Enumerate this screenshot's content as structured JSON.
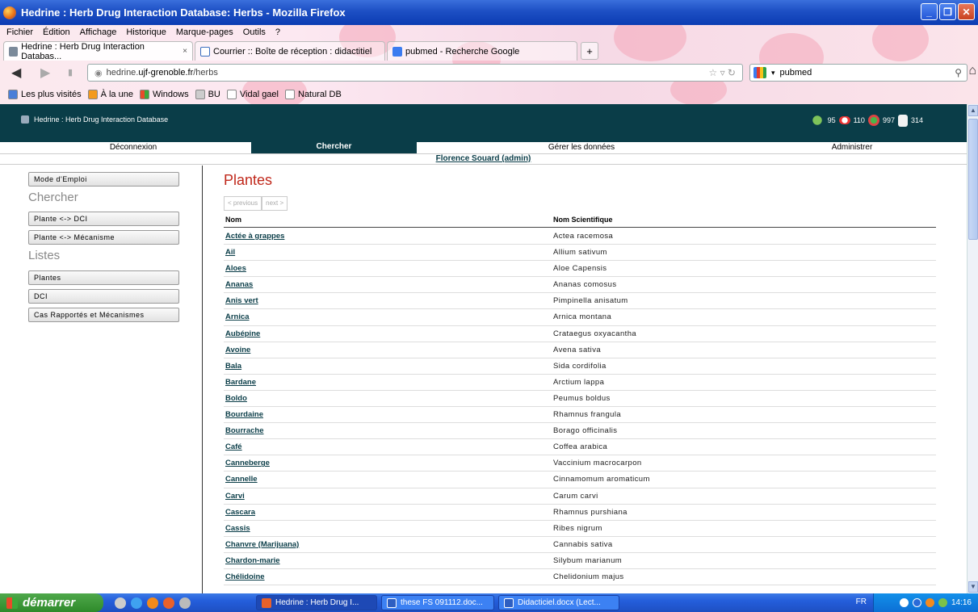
{
  "window": {
    "title": "Hedrine : Herb Drug Interaction Database: Herbs - Mozilla Firefox"
  },
  "menu": [
    "Fichier",
    "Édition",
    "Affichage",
    "Historique",
    "Marque-pages",
    "Outils",
    "?"
  ],
  "tabs": [
    {
      "label": "Hedrine : Herb Drug Interaction Databas...",
      "close": "×"
    },
    {
      "label": "Courrier :: Boîte de réception : didactitiel"
    },
    {
      "label": "pubmed - Recherche Google"
    }
  ],
  "tab_add": "+",
  "url": {
    "prefix": "hedrine.",
    "domain": "ujf-grenoble.fr",
    "path": "/herbs"
  },
  "search": {
    "value": "pubmed"
  },
  "bookmarks": [
    "Les plus visités",
    "À la une",
    "Windows",
    "BU",
    "Vidal gael",
    "Natural DB"
  ],
  "site": {
    "brand": "Hedrine : Herb Drug Interaction Database",
    "stats": [
      "95",
      "110",
      "997",
      "314"
    ],
    "nav": [
      "Déconnexion",
      "Chercher",
      "Gérer les données",
      "Administrer"
    ],
    "user": "Florence Souard (admin)"
  },
  "sidebar": {
    "mode": "Mode d'Emploi",
    "chercher_heading": "Chercher",
    "plante_dci": "Plante <-> DCI",
    "plante_meca": "Plante <-> Mécanisme",
    "listes_heading": "Listes",
    "plantes": "Plantes",
    "dci": "DCI",
    "cas": "Cas Rapportés et Mécanismes"
  },
  "main": {
    "title": "Plantes",
    "prev": "< previous",
    "next": "next >",
    "col_nom": "Nom",
    "col_sci": "Nom Scientifique",
    "rows": [
      {
        "nom": "Actée à grappes",
        "sci": "Actea racemosa"
      },
      {
        "nom": "Ail",
        "sci": "Allium sativum"
      },
      {
        "nom": "Aloes",
        "sci": "Aloe Capensis"
      },
      {
        "nom": "Ananas",
        "sci": "Ananas comosus"
      },
      {
        "nom": "Anis vert",
        "sci": "Pimpinella anisatum"
      },
      {
        "nom": "Arnica",
        "sci": "Arnica montana"
      },
      {
        "nom": "Aubépine",
        "sci": "Crataegus oxyacantha"
      },
      {
        "nom": "Avoine",
        "sci": "Avena sativa"
      },
      {
        "nom": "Bala",
        "sci": "Sida cordifolia"
      },
      {
        "nom": "Bardane",
        "sci": "Arctium lappa"
      },
      {
        "nom": "Boldo",
        "sci": "Peumus boldus"
      },
      {
        "nom": "Bourdaine",
        "sci": "Rhamnus frangula"
      },
      {
        "nom": "Bourrache",
        "sci": "Borago officinalis"
      },
      {
        "nom": "Café",
        "sci": "Coffea arabica"
      },
      {
        "nom": "Canneberge",
        "sci": "Vaccinium macrocarpon"
      },
      {
        "nom": "Cannelle",
        "sci": "Cinnamomum aromaticum"
      },
      {
        "nom": "Carvi",
        "sci": "Carum carvi"
      },
      {
        "nom": "Cascara",
        "sci": "Rhamnus purshiana"
      },
      {
        "nom": "Cassis",
        "sci": "Ribes nigrum"
      },
      {
        "nom": "Chanvre (Marijuana)",
        "sci": "Cannabis sativa"
      },
      {
        "nom": "Chardon-marie",
        "sci": "Silybum marianum"
      },
      {
        "nom": "Chélidoine",
        "sci": "Chelidonium majus"
      }
    ]
  },
  "taskbar": {
    "start": "démarrer",
    "tasks": [
      "Hedrine : Herb Drug I...",
      "these FS 091112.doc...",
      "Didacticiel.docx (Lect..."
    ],
    "lang": "FR",
    "clock": "14:16"
  }
}
